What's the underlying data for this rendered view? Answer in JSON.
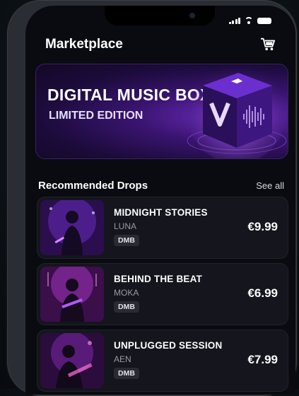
{
  "header": {
    "title": "Marketplace",
    "cart_icon": "cart-icon"
  },
  "banner": {
    "title": "DIGITAL MUSIC BOX",
    "subtitle": "LIMITED EDITION",
    "art": "music-box-cube",
    "accent": "#7a3cff"
  },
  "section": {
    "title": "Recommended Drops",
    "see_all": "See all"
  },
  "items": [
    {
      "title": "MIDNIGHT STORIES",
      "artist": "LUNA",
      "badge": "DMB",
      "price": "€9.99"
    },
    {
      "title": "BEHIND THE BEAT",
      "artist": "MOKA",
      "badge": "DMB",
      "price": "€6.99"
    },
    {
      "title": "UNPLUGGED SESSION",
      "artist": "AEN",
      "badge": "DMB",
      "price": "€7.99"
    }
  ]
}
